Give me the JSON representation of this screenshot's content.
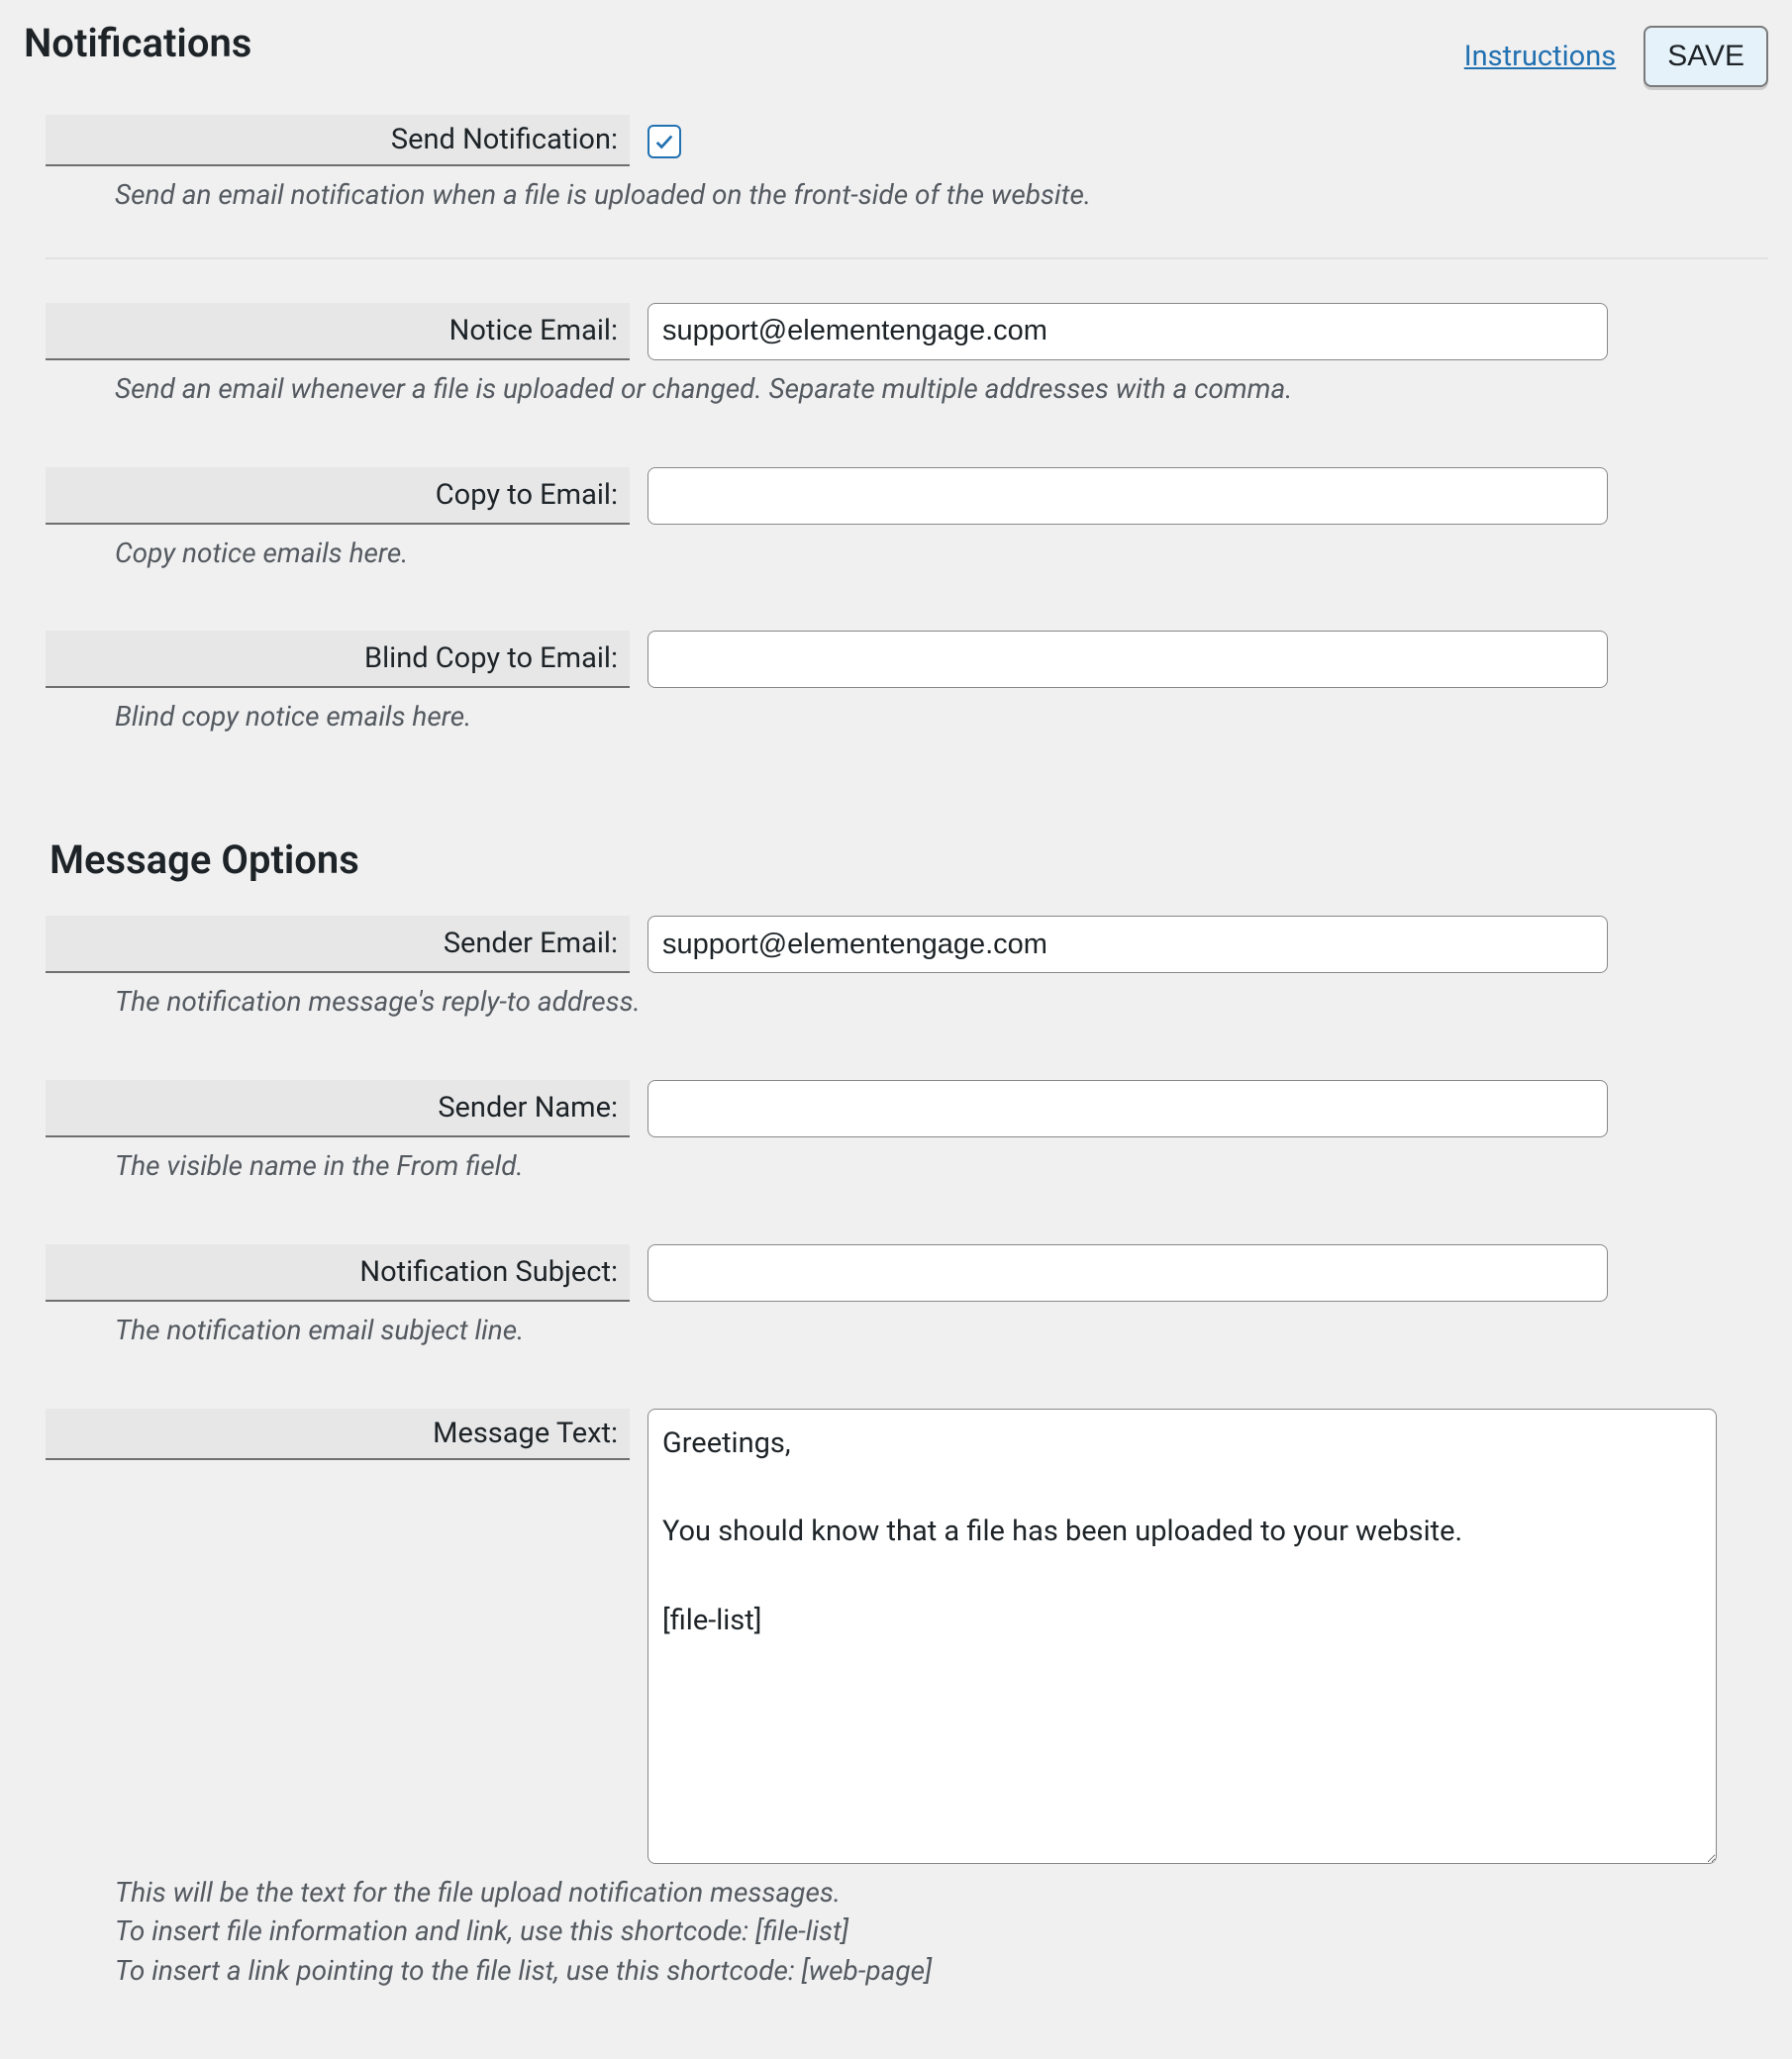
{
  "header": {
    "title": "Notifications",
    "instructions_label": "Instructions",
    "save_label": "SAVE"
  },
  "section_message_options_title": "Message Options",
  "fields": {
    "send_notification": {
      "label": "Send Notification:",
      "checked": true,
      "helper": "Send an email notification when a file is uploaded on the front-side of the website."
    },
    "notice_email": {
      "label": "Notice Email:",
      "value": "support@elementengage.com",
      "helper": "Send an email whenever a file is uploaded or changed. Separate multiple addresses with a comma."
    },
    "copy_to_email": {
      "label": "Copy to Email:",
      "value": "",
      "helper": "Copy notice emails here."
    },
    "blind_copy_to_email": {
      "label": "Blind Copy to Email:",
      "value": "",
      "helper": "Blind copy notice emails here."
    },
    "sender_email": {
      "label": "Sender Email:",
      "value": "support@elementengage.com",
      "helper": "The notification message's reply-to address."
    },
    "sender_name": {
      "label": "Sender Name:",
      "value": "",
      "helper": "The visible name in the From field."
    },
    "notification_subject": {
      "label": "Notification Subject:",
      "value": "",
      "helper": "The notification email subject line."
    },
    "message_text": {
      "label": "Message Text:",
      "value": "Greetings,\n\nYou should know that a file has been uploaded to your website.\n\n[file-list]",
      "helper_line1": "This will be the text for the file upload notification messages.",
      "helper_line2": "To insert file information and link, use this shortcode: [file-list]",
      "helper_line3": "To insert a link pointing to the file list, use this shortcode: [web-page]"
    }
  }
}
